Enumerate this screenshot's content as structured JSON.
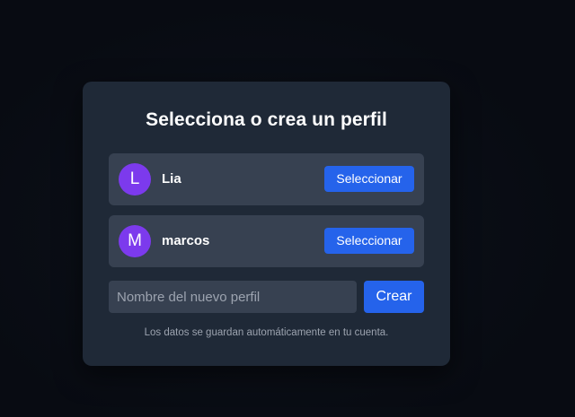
{
  "profile_picker": {
    "title": "Selecciona o crea un perfil",
    "profiles": [
      {
        "initial": "L",
        "name": "Lia",
        "select_label": "Seleccionar"
      },
      {
        "initial": "M",
        "name": "marcos",
        "select_label": "Seleccionar"
      }
    ],
    "new_profile": {
      "placeholder": "Nombre del nuevo perfil",
      "value": "",
      "create_label": "Crear"
    },
    "footer_note": "Los datos se guardan automáticamente en tu cuenta."
  },
  "colors": {
    "background": "#090d14",
    "card": "#1f2937",
    "row": "#374151",
    "avatar": "#7c3aed",
    "accent": "#2563eb"
  }
}
